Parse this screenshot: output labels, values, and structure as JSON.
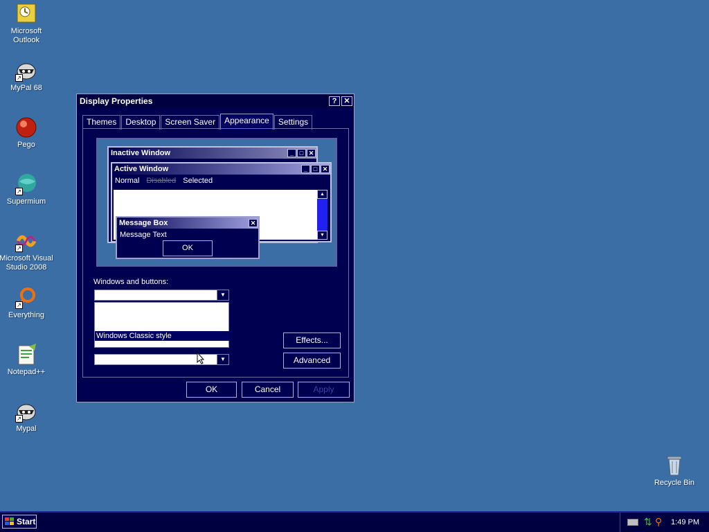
{
  "desktop": {
    "icons": [
      {
        "label": "Microsoft Outlook",
        "icon": "outlook-icon"
      },
      {
        "label": "MyPal 68",
        "icon": "mypal-icon"
      },
      {
        "label": "Pego",
        "icon": "pego-icon"
      },
      {
        "label": "Supermium",
        "icon": "supermium-icon"
      },
      {
        "label": "Microsoft Visual Studio 2008",
        "icon": "visual-studio-icon"
      },
      {
        "label": "Everything",
        "icon": "everything-icon"
      },
      {
        "label": "Notepad++",
        "icon": "notepadpp-icon"
      },
      {
        "label": "Mypal",
        "icon": "mypal-icon"
      },
      {
        "label": "Recycle Bin",
        "icon": "recycle-bin-icon"
      }
    ]
  },
  "dialog": {
    "title": "Display Properties",
    "help_label": "?",
    "close_label": "✕",
    "tabs": [
      "Themes",
      "Desktop",
      "Screen Saver",
      "Appearance",
      "Settings"
    ],
    "active_tab": "Appearance",
    "preview": {
      "inactive_title": "Inactive Window",
      "active_title": "Active Window",
      "menu_normal": "Normal",
      "menu_disabled": "Disabled",
      "menu_selected": "Selected",
      "msgbox_title": "Message Box",
      "msgbox_text": "Message Text",
      "msgbox_ok": "OK"
    },
    "windows_buttons_label": "Windows and buttons:",
    "windows_buttons_value": "",
    "dropdown_option": "Windows Classic style",
    "font_size_value": "",
    "effects_label": "Effects...",
    "advanced_label": "Advanced",
    "ok_label": "OK",
    "cancel_label": "Cancel",
    "apply_label": "Apply"
  },
  "taskbar": {
    "start_label": "Start",
    "clock": "1:49 PM"
  },
  "colors": {
    "desktop": "#3a6ea5",
    "dialog_bg": "#000050",
    "selection": "#000060"
  }
}
